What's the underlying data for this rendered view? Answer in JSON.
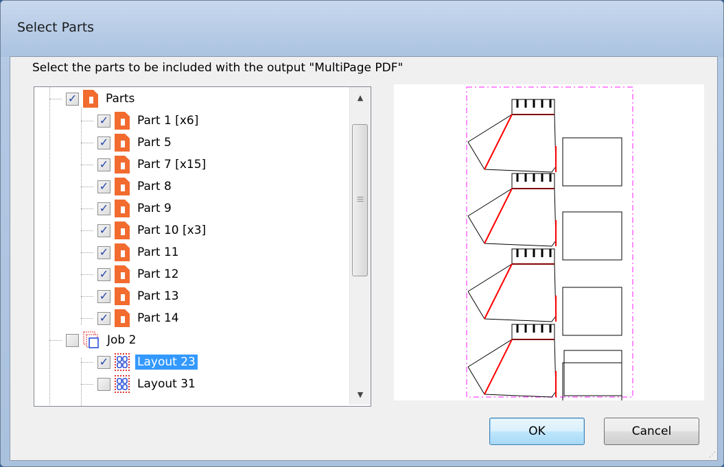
{
  "window": {
    "title": "Select Parts"
  },
  "prompt": "Select the parts to be included with the output \"MultiPage PDF\"",
  "tree": {
    "items": [
      {
        "label": "Parts",
        "level": 0,
        "type": "parts-folder",
        "checked": true,
        "selected": false
      },
      {
        "label": "Part 1 [x6]",
        "level": 1,
        "type": "part",
        "checked": true,
        "selected": false
      },
      {
        "label": "Part 5",
        "level": 1,
        "type": "part",
        "checked": true,
        "selected": false
      },
      {
        "label": "Part 7 [x15]",
        "level": 1,
        "type": "part",
        "checked": true,
        "selected": false
      },
      {
        "label": "Part 8",
        "level": 1,
        "type": "part",
        "checked": true,
        "selected": false
      },
      {
        "label": "Part 9",
        "level": 1,
        "type": "part",
        "checked": true,
        "selected": false
      },
      {
        "label": "Part 10 [x3]",
        "level": 1,
        "type": "part",
        "checked": true,
        "selected": false
      },
      {
        "label": "Part 11",
        "level": 1,
        "type": "part",
        "checked": true,
        "selected": false
      },
      {
        "label": "Part 12",
        "level": 1,
        "type": "part",
        "checked": true,
        "selected": false
      },
      {
        "label": "Part 13",
        "level": 1,
        "type": "part",
        "checked": true,
        "selected": false
      },
      {
        "label": "Part 14",
        "level": 1,
        "type": "part",
        "checked": true,
        "selected": false
      },
      {
        "label": "Job 2",
        "level": 0,
        "type": "job",
        "checked": false,
        "selected": false
      },
      {
        "label": "Layout 23",
        "level": 1,
        "type": "layout",
        "checked": true,
        "selected": true
      },
      {
        "label": "Layout 31",
        "level": 1,
        "type": "layout",
        "checked": false,
        "selected": false
      }
    ]
  },
  "buttons": {
    "ok": "OK",
    "cancel": "Cancel"
  },
  "colors": {
    "part_icon": "#f26b2f",
    "selection": "#3399ff",
    "nest_boundary": "#ff66ff",
    "cut_line": "#ff0000"
  }
}
